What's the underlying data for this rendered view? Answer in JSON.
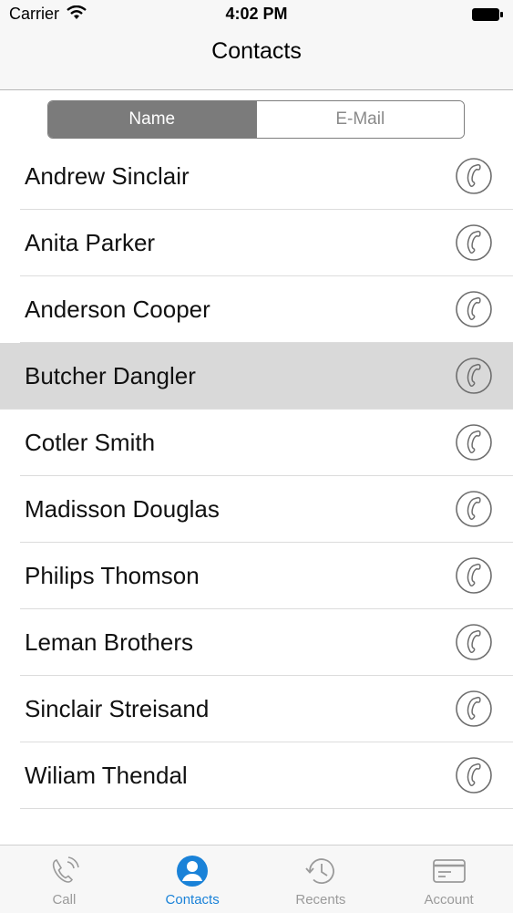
{
  "status_bar": {
    "carrier": "Carrier",
    "time": "4:02 PM"
  },
  "nav": {
    "title": "Contacts"
  },
  "segments": [
    {
      "label": "Name",
      "active": true
    },
    {
      "label": "E-Mail",
      "active": false
    }
  ],
  "contacts": [
    {
      "name": "Andrew Sinclair",
      "selected": false
    },
    {
      "name": "Anita Parker",
      "selected": false
    },
    {
      "name": "Anderson Cooper",
      "selected": false
    },
    {
      "name": "Butcher Dangler",
      "selected": true
    },
    {
      "name": "Cotler Smith",
      "selected": false
    },
    {
      "name": "Madisson Douglas",
      "selected": false
    },
    {
      "name": "Philips Thomson",
      "selected": false
    },
    {
      "name": "Leman Brothers",
      "selected": false
    },
    {
      "name": "Sinclair Streisand",
      "selected": false
    },
    {
      "name": "Wiliam Thendal",
      "selected": false
    }
  ],
  "tabs": [
    {
      "label": "Call",
      "icon": "phone-icon",
      "active": false
    },
    {
      "label": "Contacts",
      "icon": "person-icon",
      "active": true
    },
    {
      "label": "Recents",
      "icon": "clock-history-icon",
      "active": false
    },
    {
      "label": "Account",
      "icon": "card-icon",
      "active": false
    }
  ],
  "colors": {
    "accent": "#1a82d8",
    "selected_row": "#d9d9d9",
    "segment_active": "#7b7b7b"
  }
}
